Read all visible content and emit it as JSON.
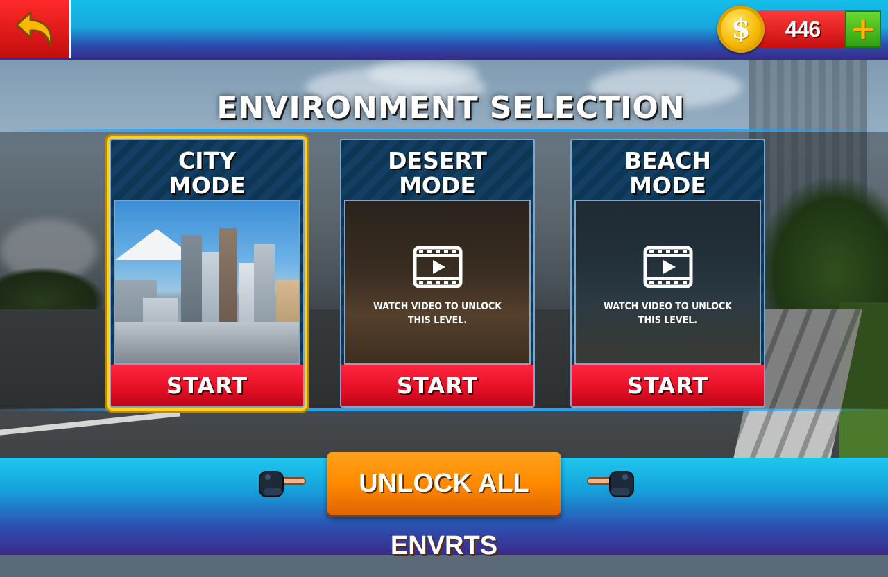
{
  "header": {
    "back_icon": "back-arrow-icon",
    "coins": "446",
    "coin_icon": "dollar-coin-icon",
    "add_coins_symbol": "+",
    "coin_symbol": "$"
  },
  "title": "ENVIRONMENT SELECTION",
  "modes": [
    {
      "title_line1": "CITY",
      "title_line2": "MODE",
      "locked": false,
      "selected": true,
      "start_label": "START"
    },
    {
      "title_line1": "DESERT",
      "title_line2": "MODE",
      "locked": true,
      "selected": false,
      "lock_line1": "WATCH VIDEO TO UNLOCK",
      "lock_line2": "THIS LEVEL.",
      "start_label": "START"
    },
    {
      "title_line1": "BEACH",
      "title_line2": "MODE",
      "locked": true,
      "selected": false,
      "lock_line1": "WATCH VIDEO TO UNLOCK",
      "lock_line2": "THIS LEVEL.",
      "start_label": "START"
    }
  ],
  "footer": {
    "unlock_all_label": "UNLOCK ALL ENVRTS",
    "pointer_icon": "pointing-hand-icon"
  },
  "colors": {
    "accent_red": "#e30e24",
    "accent_orange": "#ff8a00",
    "selection_gold": "#ffd21f",
    "bar_cyan": "#18a8dc"
  }
}
